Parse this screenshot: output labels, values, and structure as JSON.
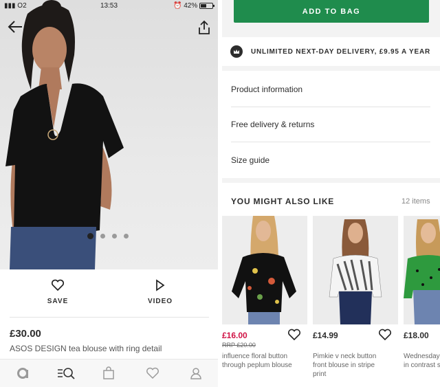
{
  "status_bar": {
    "carrier": "O2",
    "time": "13:53",
    "battery": "42%"
  },
  "product": {
    "price": "£30.00",
    "name": "ASOS DESIGN tea blouse with ring detail",
    "image_count": 4,
    "active_image": 1,
    "save_label": "SAVE",
    "video_label": "VIDEO"
  },
  "tabbar": {
    "items": [
      "home-icon",
      "search-icon",
      "bag-icon",
      "saved-icon",
      "account-icon"
    ]
  },
  "details": {
    "add_to_bag": "ADD TO BAG",
    "delivery_banner": "UNLIMITED NEXT-DAY DELIVERY, £9.95 A YEAR",
    "links": [
      "Product information",
      "Free delivery & returns",
      "Size guide"
    ]
  },
  "recommendations": {
    "title": "YOU MIGHT ALSO LIKE",
    "count": "12 items",
    "items": [
      {
        "price": "£16.00",
        "rrp": "RRP £20.00",
        "name": "influence floral button through peplum blouse",
        "sale": true
      },
      {
        "price": "£14.99",
        "name": "Pimkie v neck button front blouse in stripe print",
        "sale": false
      },
      {
        "price": "£18.00",
        "name": "Wednesday's Girl blouse in contrast spot",
        "sale": false
      }
    ]
  },
  "colors": {
    "accent_green": "#1f8c4d",
    "sale_red": "#d01345",
    "text_dark": "#2d2d2d"
  }
}
